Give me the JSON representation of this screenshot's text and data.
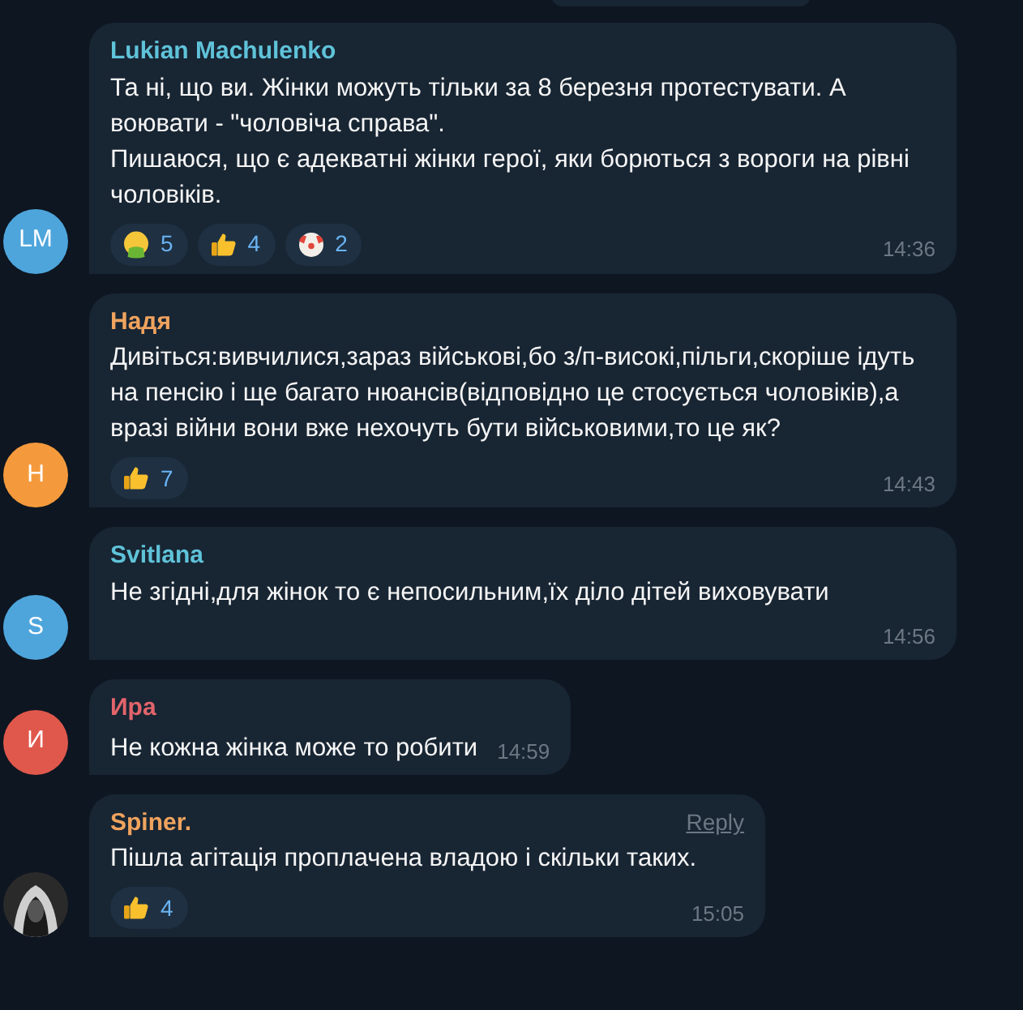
{
  "messages": [
    {
      "author": "Lukian Machulenko",
      "color": "#5fc3d9",
      "avatar": {
        "kind": "initials",
        "initials": "LM",
        "color": "#4ea5dc"
      },
      "paragraphs": [
        "Та ні, що ви. Жінки можуть тільки за 8 березня протестувати. А воювати - \"чоловіча справа\".",
        "Пишаюся, що є адекватні жінки герої, яки борються з вороги на рівні чоловіків."
      ],
      "reactions": [
        {
          "kind": "sick",
          "count": "5"
        },
        {
          "kind": "thumbs",
          "count": "4"
        },
        {
          "kind": "clown",
          "count": "2"
        }
      ],
      "time": "14:36",
      "kind": "wide"
    },
    {
      "author": "Надя",
      "color": "#f0a35e",
      "avatar": {
        "kind": "initials",
        "initials": "Н",
        "color": "#f49a3c"
      },
      "paragraphs": [
        "Дивіться:вивчилися,зараз військові,бо з/п-високі,пільги,скоріше ідуть на пенсію і ще багато нюансів(відповідно це стосується чоловіків),а вразі війни вони вже нехочуть бути військовими,то це як?"
      ],
      "reactions": [
        {
          "kind": "thumbs",
          "count": "7"
        }
      ],
      "time": "14:43",
      "kind": "wide"
    },
    {
      "author": "Svitlana",
      "color": "#5fc3d9",
      "avatar": {
        "kind": "initials",
        "initials": "S",
        "color": "#4ea5dc"
      },
      "paragraphs": [
        "Не згідні,для жінок то є непосильним,їх діло дітей виховувати"
      ],
      "time": "14:56",
      "kind": "wide"
    },
    {
      "author": "Ира",
      "color": "#e2646b",
      "avatar": {
        "kind": "initials",
        "initials": "И",
        "color": "#e0584c"
      },
      "paragraphs": [
        "Не кожна жінка може то робити"
      ],
      "time": "14:59",
      "kind": "inline"
    },
    {
      "author": "Spiner.",
      "color": "#f0a35e",
      "avatar": {
        "kind": "picture"
      },
      "reply": "Reply",
      "paragraphs": [
        "Пішла агітація проплачена владою і скільки таких."
      ],
      "reactions": [
        {
          "kind": "thumbs",
          "count": "4"
        }
      ],
      "time": "15:05",
      "kind": "fit"
    }
  ]
}
